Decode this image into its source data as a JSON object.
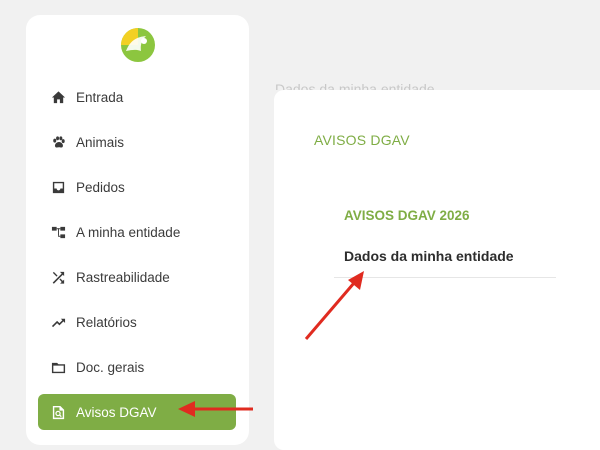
{
  "sidebar": {
    "logo": "logo-icon",
    "items": [
      {
        "label": "Entrada",
        "icon": "home-icon"
      },
      {
        "label": "Animais",
        "icon": "paw-icon"
      },
      {
        "label": "Pedidos",
        "icon": "inbox-icon"
      },
      {
        "label": "A minha entidade",
        "icon": "org-chart-icon"
      },
      {
        "label": "Rastreabilidade",
        "icon": "shuffle-icon"
      },
      {
        "label": "Relatórios",
        "icon": "trending-up-icon"
      },
      {
        "label": "Doc. gerais",
        "icon": "folder-icon"
      },
      {
        "label": "Avisos DGAV",
        "icon": "document-search-icon",
        "active": true
      }
    ]
  },
  "background_title": "Dados da minha entidade",
  "main": {
    "section_title": "AVISOS DGAV",
    "group_title": "AVISOS DGAV 2026",
    "link_label": "Dados da minha entidade"
  },
  "colors": {
    "accent": "#7fad45",
    "annotation_arrow": "#e02b20",
    "background": "#f1f1f1"
  }
}
